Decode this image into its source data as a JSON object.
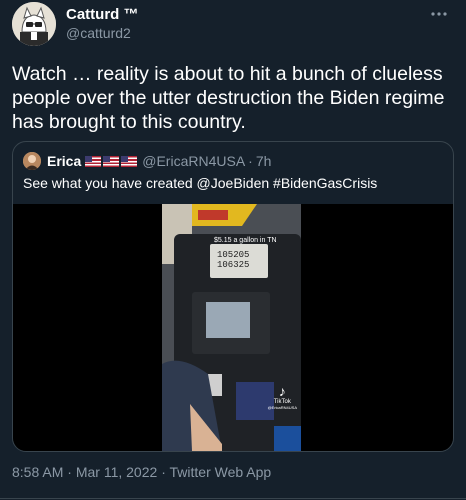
{
  "author": {
    "display_name": "Catturd ™",
    "handle": "@catturd2"
  },
  "more_icon": "more-horizontal-icon",
  "tweet_text": "Watch … reality is about to hit a bunch of clueless people over the utter destruction the Biden regime has brought to this country.",
  "quote": {
    "display_name": "Erica",
    "flag_icons": [
      "us-flag-icon",
      "us-flag-icon",
      "us-flag-icon"
    ],
    "handle": "@EricaRN4USA",
    "separator": "·",
    "time": "7h",
    "text": "See what you have created @JoeBiden #BidenGasCrisis",
    "video": {
      "caption": "$5.15 a gallon in TN",
      "pump_display_top": "105205",
      "pump_display_bottom": "106325",
      "watermark": "TikTok",
      "watermark_handle": "@EricaRN4USA"
    }
  },
  "meta": {
    "time": "8:58 AM",
    "dot1": "·",
    "date": "Mar 11, 2022",
    "dot2": "·",
    "source": "Twitter Web App"
  }
}
